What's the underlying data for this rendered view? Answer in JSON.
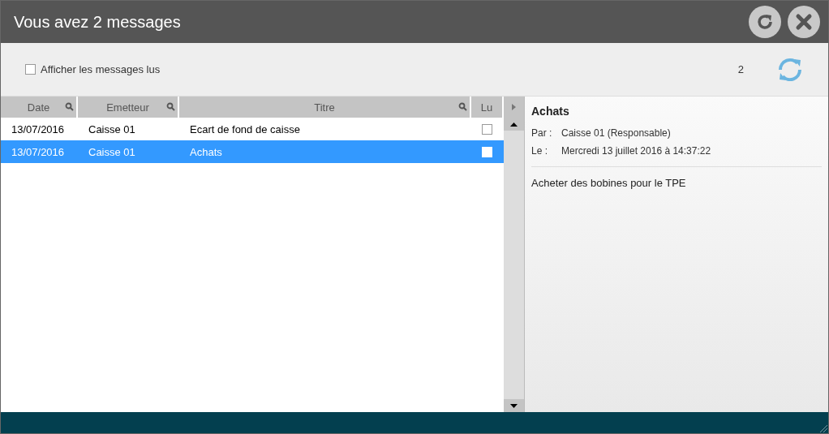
{
  "window": {
    "title": "Vous avez 2 messages"
  },
  "toolbar": {
    "show_read": {
      "label": "Afficher les messages lus",
      "checked": false
    },
    "count": "2"
  },
  "table": {
    "columns": [
      {
        "label": "Date",
        "searchable": true
      },
      {
        "label": "Emetteur",
        "searchable": true
      },
      {
        "label": "Titre",
        "searchable": true
      },
      {
        "label": "Lu",
        "searchable": false
      }
    ],
    "rows": [
      {
        "date": "13/07/2016",
        "sender": "Caisse 01",
        "title": "Ecart de fond de caisse",
        "read": false,
        "selected": false
      },
      {
        "date": "13/07/2016",
        "sender": "Caisse 01",
        "title": "Achats",
        "read": false,
        "selected": true
      }
    ]
  },
  "detail": {
    "title": "Achats",
    "fields": [
      {
        "label": "Par :",
        "value": "Caisse 01 (Responsable)"
      },
      {
        "label": "Le :",
        "value": "Mercredi 13 juillet 2016 à 14:37:22"
      }
    ],
    "body": "Acheter des bobines pour le TPE"
  }
}
